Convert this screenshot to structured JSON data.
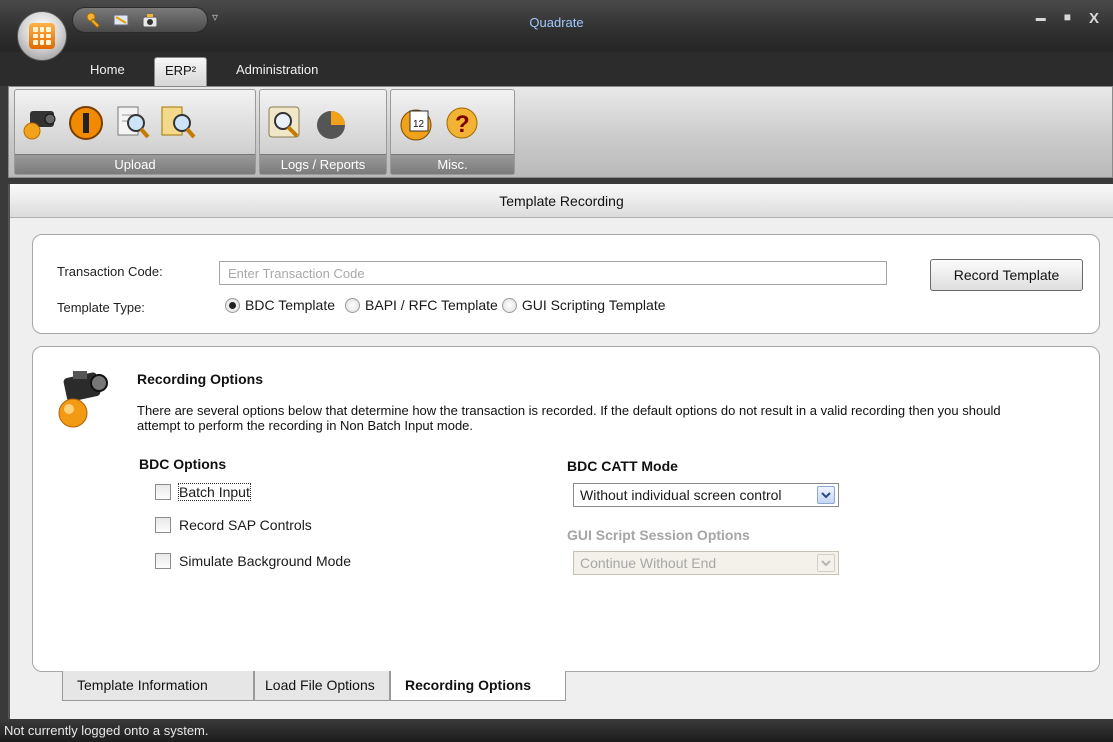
{
  "window": {
    "title": "Quadrate",
    "minimize": "▬",
    "maximize": "■",
    "close": "X"
  },
  "quick_access": {
    "more": "▿"
  },
  "ribbon_tabs": [
    {
      "label": "Home"
    },
    {
      "label": "ERP²"
    },
    {
      "label": "Administration"
    }
  ],
  "ribbon_groups": {
    "upload": {
      "label": "Upload"
    },
    "logs": {
      "label": "Logs / Reports"
    },
    "misc": {
      "label": "Misc."
    }
  },
  "view": {
    "title": "Template Recording"
  },
  "transaction": {
    "label": "Transaction Code:",
    "placeholder": "Enter Transaction Code",
    "value": "",
    "record_button": "Record Template"
  },
  "template_type": {
    "label": "Template Type:",
    "options": [
      {
        "label": "BDC Template",
        "selected": true
      },
      {
        "label": "BAPI / RFC Template",
        "selected": false
      },
      {
        "label": "GUI Scripting Template",
        "selected": false
      }
    ]
  },
  "recording_options": {
    "title": "Recording Options",
    "description": "There are several options below that determine how the transaction is recorded. If the default options do not result in a valid recording then you should attempt to perform the recording in Non Batch Input mode.",
    "bdc_options_title": "BDC Options",
    "bdc_options": [
      {
        "label": "Batch Input",
        "checked": false
      },
      {
        "label": "Record SAP Controls",
        "checked": false
      },
      {
        "label": "Simulate Background Mode",
        "checked": false
      }
    ],
    "catt_mode_title": "BDC CATT Mode",
    "catt_mode_value": "Without individual screen control",
    "gui_session_title": "GUI Script Session Options",
    "gui_session_value": "Continue Without End"
  },
  "bottom_tabs": [
    {
      "label": "Template Information"
    },
    {
      "label": "Load File Options"
    },
    {
      "label": "Recording Options"
    }
  ],
  "status": {
    "text": "Not currently logged onto a system."
  }
}
